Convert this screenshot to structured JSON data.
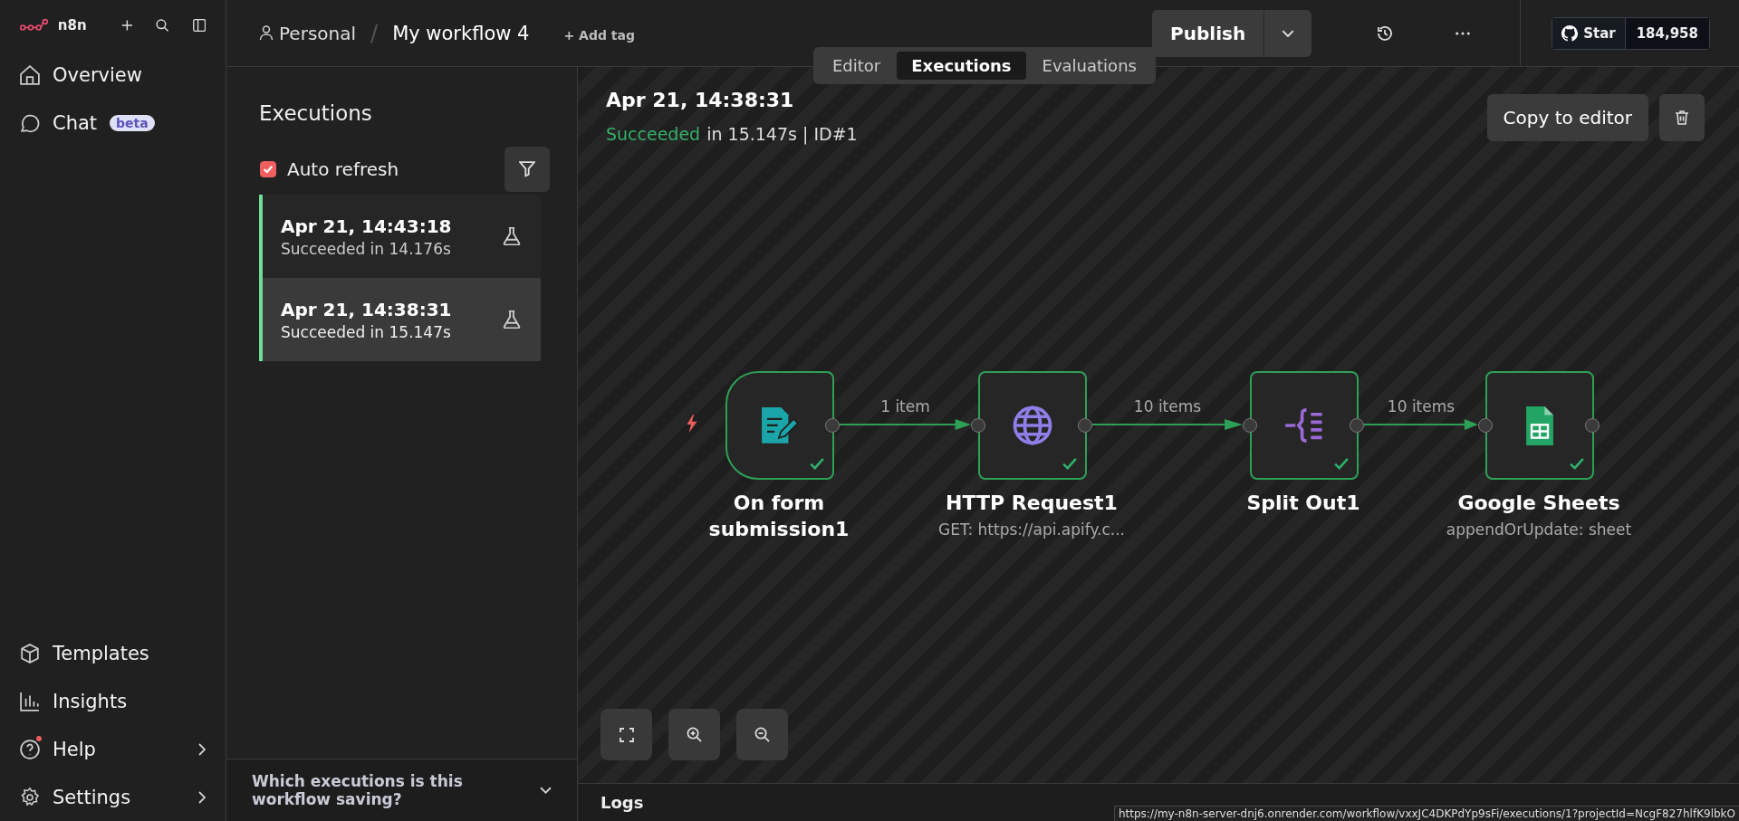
{
  "sidebar": {
    "brand": "n8n",
    "top_items": [
      {
        "label": "Overview"
      },
      {
        "label": "Chat",
        "badge": "beta"
      }
    ],
    "bottom_items": [
      {
        "label": "Templates",
        "expandable": false,
        "notification": false
      },
      {
        "label": "Insights",
        "expandable": false,
        "notification": false
      },
      {
        "label": "Help",
        "expandable": true,
        "notification": true
      },
      {
        "label": "Settings",
        "expandable": true,
        "notification": false
      }
    ]
  },
  "header": {
    "project": "Personal",
    "separator": "/",
    "workflow_name": "My workflow 4",
    "add_tag": "+ Add tag",
    "publish": "Publish",
    "github_star": "Star",
    "github_count": "184,958"
  },
  "view_tabs": [
    {
      "label": "Editor",
      "selected": false
    },
    {
      "label": "Executions",
      "selected": true
    },
    {
      "label": "Evaluations",
      "selected": false
    }
  ],
  "executions_panel": {
    "title": "Executions",
    "auto_refresh": {
      "label": "Auto refresh",
      "checked": true
    },
    "items": [
      {
        "time": "Apr 21, 14:43:18",
        "status": "Succeeded in 14.176s",
        "selected": false
      },
      {
        "time": "Apr 21, 14:38:31",
        "status": "Succeeded in 15.147s",
        "selected": true
      }
    ],
    "footer": "Which executions is this workflow saving?"
  },
  "execution_detail": {
    "time": "Apr 21, 14:38:31",
    "status": "Succeeded",
    "details": "in 15.147s | ID#1",
    "copy_button": "Copy to editor"
  },
  "nodes": [
    {
      "kind": "trigger",
      "title": "On form submission1",
      "succeeded": true
    },
    {
      "kind": "http",
      "title": "HTTP Request1",
      "subtitle": "GET: https://api.apify.c...",
      "succeeded": true
    },
    {
      "kind": "split",
      "title": "Split Out1",
      "succeeded": true
    },
    {
      "kind": "sheets",
      "title": "Google Sheets",
      "subtitle": "appendOrUpdate: sheet",
      "succeeded": true
    }
  ],
  "connections": [
    {
      "label": "1 item"
    },
    {
      "label": "10 items"
    },
    {
      "label": "10 items"
    }
  ],
  "logs": "Logs",
  "status_url": "https://my-n8n-server-dnj6.onrender.com/workflow/vxxJC4DKPdYp9sFi/executions/1?projectId=NcgF827hlfK9lbkO"
}
